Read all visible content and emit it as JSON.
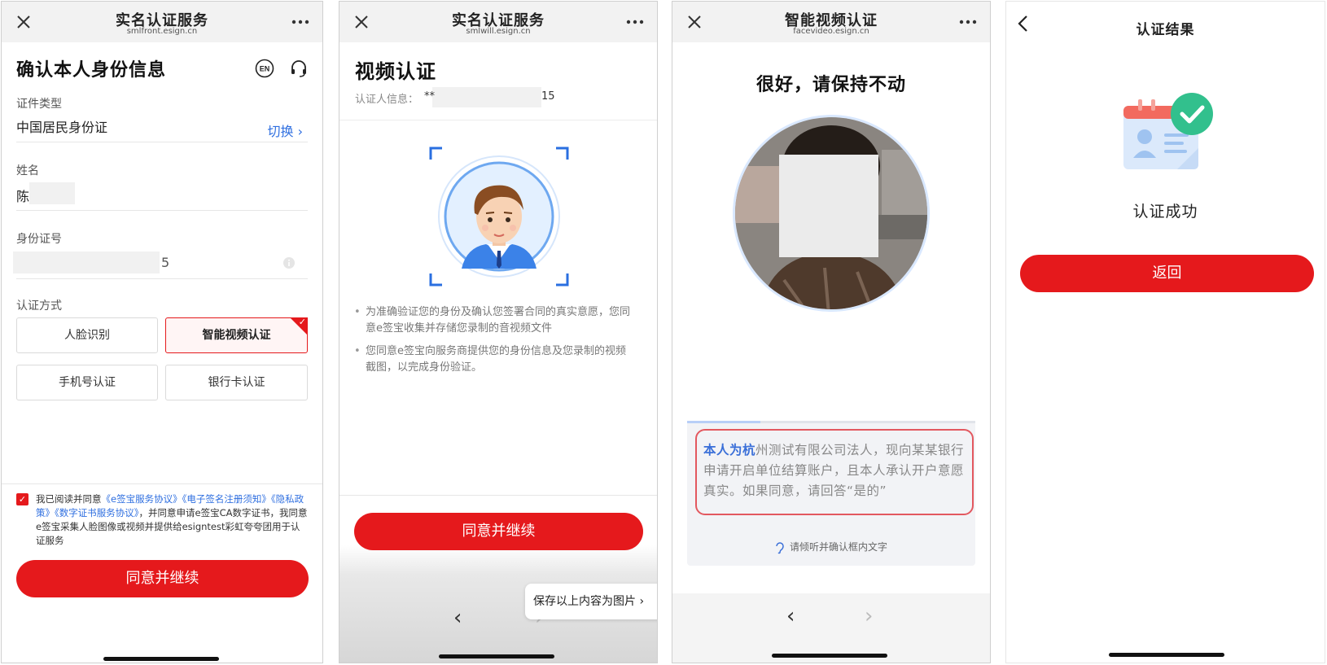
{
  "screens": [
    {
      "nav": {
        "title": "实名认证服务",
        "domain": "smlfront.esign.cn"
      },
      "page_title": "确认本人身份信息",
      "cert_type": {
        "label": "证件类型",
        "value": "中国居民身份证",
        "switch_label": "切换"
      },
      "name": {
        "label": "姓名",
        "value": "陈"
      },
      "id_number": {
        "label": "身份证号",
        "value": "5"
      },
      "auth_method": {
        "label": "认证方式",
        "options": [
          "人脸识别",
          "智能视频认证",
          "手机号认证",
          "银行卡认证"
        ],
        "selected": "智能视频认证"
      },
      "agreement": {
        "prefix": "我已阅读并同意",
        "link1": "《e签宝服务协议》",
        "link2": "《电子签名注册须知》",
        "link3": "《隐私政策》",
        "link4": "《数字证书服务协议》",
        "suffix": "，并同意申请e签宝CA数字证书，我同意e签宝采集人脸图像或视频并提供给esigntest彩虹夸夸团用于认证服务"
      },
      "button": "同意并继续"
    },
    {
      "nav": {
        "title": "实名认证服务",
        "domain": "smlwill.esign.cn"
      },
      "page_title": "视频认证",
      "info_label": "认证人信息：",
      "info_value": "**",
      "info_tail": "15",
      "bullets": [
        "为准确验证您的身份及确认您签署合同的真实意愿，您同意e签宝收集并存储您录制的音视频文件",
        "您同意e签宝向服务商提供您的身份信息及您录制的视频截图，以完成身份验证。"
      ],
      "button": "同意并继续",
      "save_pill": "保存以上内容为图片",
      "back_arrow": "‹",
      "forward_arrow": "›"
    },
    {
      "nav": {
        "title": "智能视频认证",
        "domain": "facevideo.esign.cn"
      },
      "hint_title": "很好，请保持不动",
      "read_text_highlight": "本人为杭",
      "read_text_rest": "州测试有限公司法人，现向某某银行申请开启单位结算账户，且本人承认开户意愿真实。如果同意，请回答“是的”",
      "listen_hint": "请倾听并确认框内文字",
      "back_arrow": "‹",
      "forward_arrow": "›"
    },
    {
      "nav": {
        "title": "认证结果"
      },
      "result": "认证成功",
      "button": "返回"
    }
  ],
  "colors": {
    "accent": "#e5191c",
    "link": "#2f6fe0",
    "highlight": "#3a6fd8"
  },
  "icons": [
    "close-icon",
    "more-icon",
    "en-language-icon",
    "headset-icon",
    "chevron-right-icon",
    "info-icon",
    "checkbox-checked-icon",
    "ear-icon",
    "back-icon",
    "id-card-success-icon"
  ]
}
